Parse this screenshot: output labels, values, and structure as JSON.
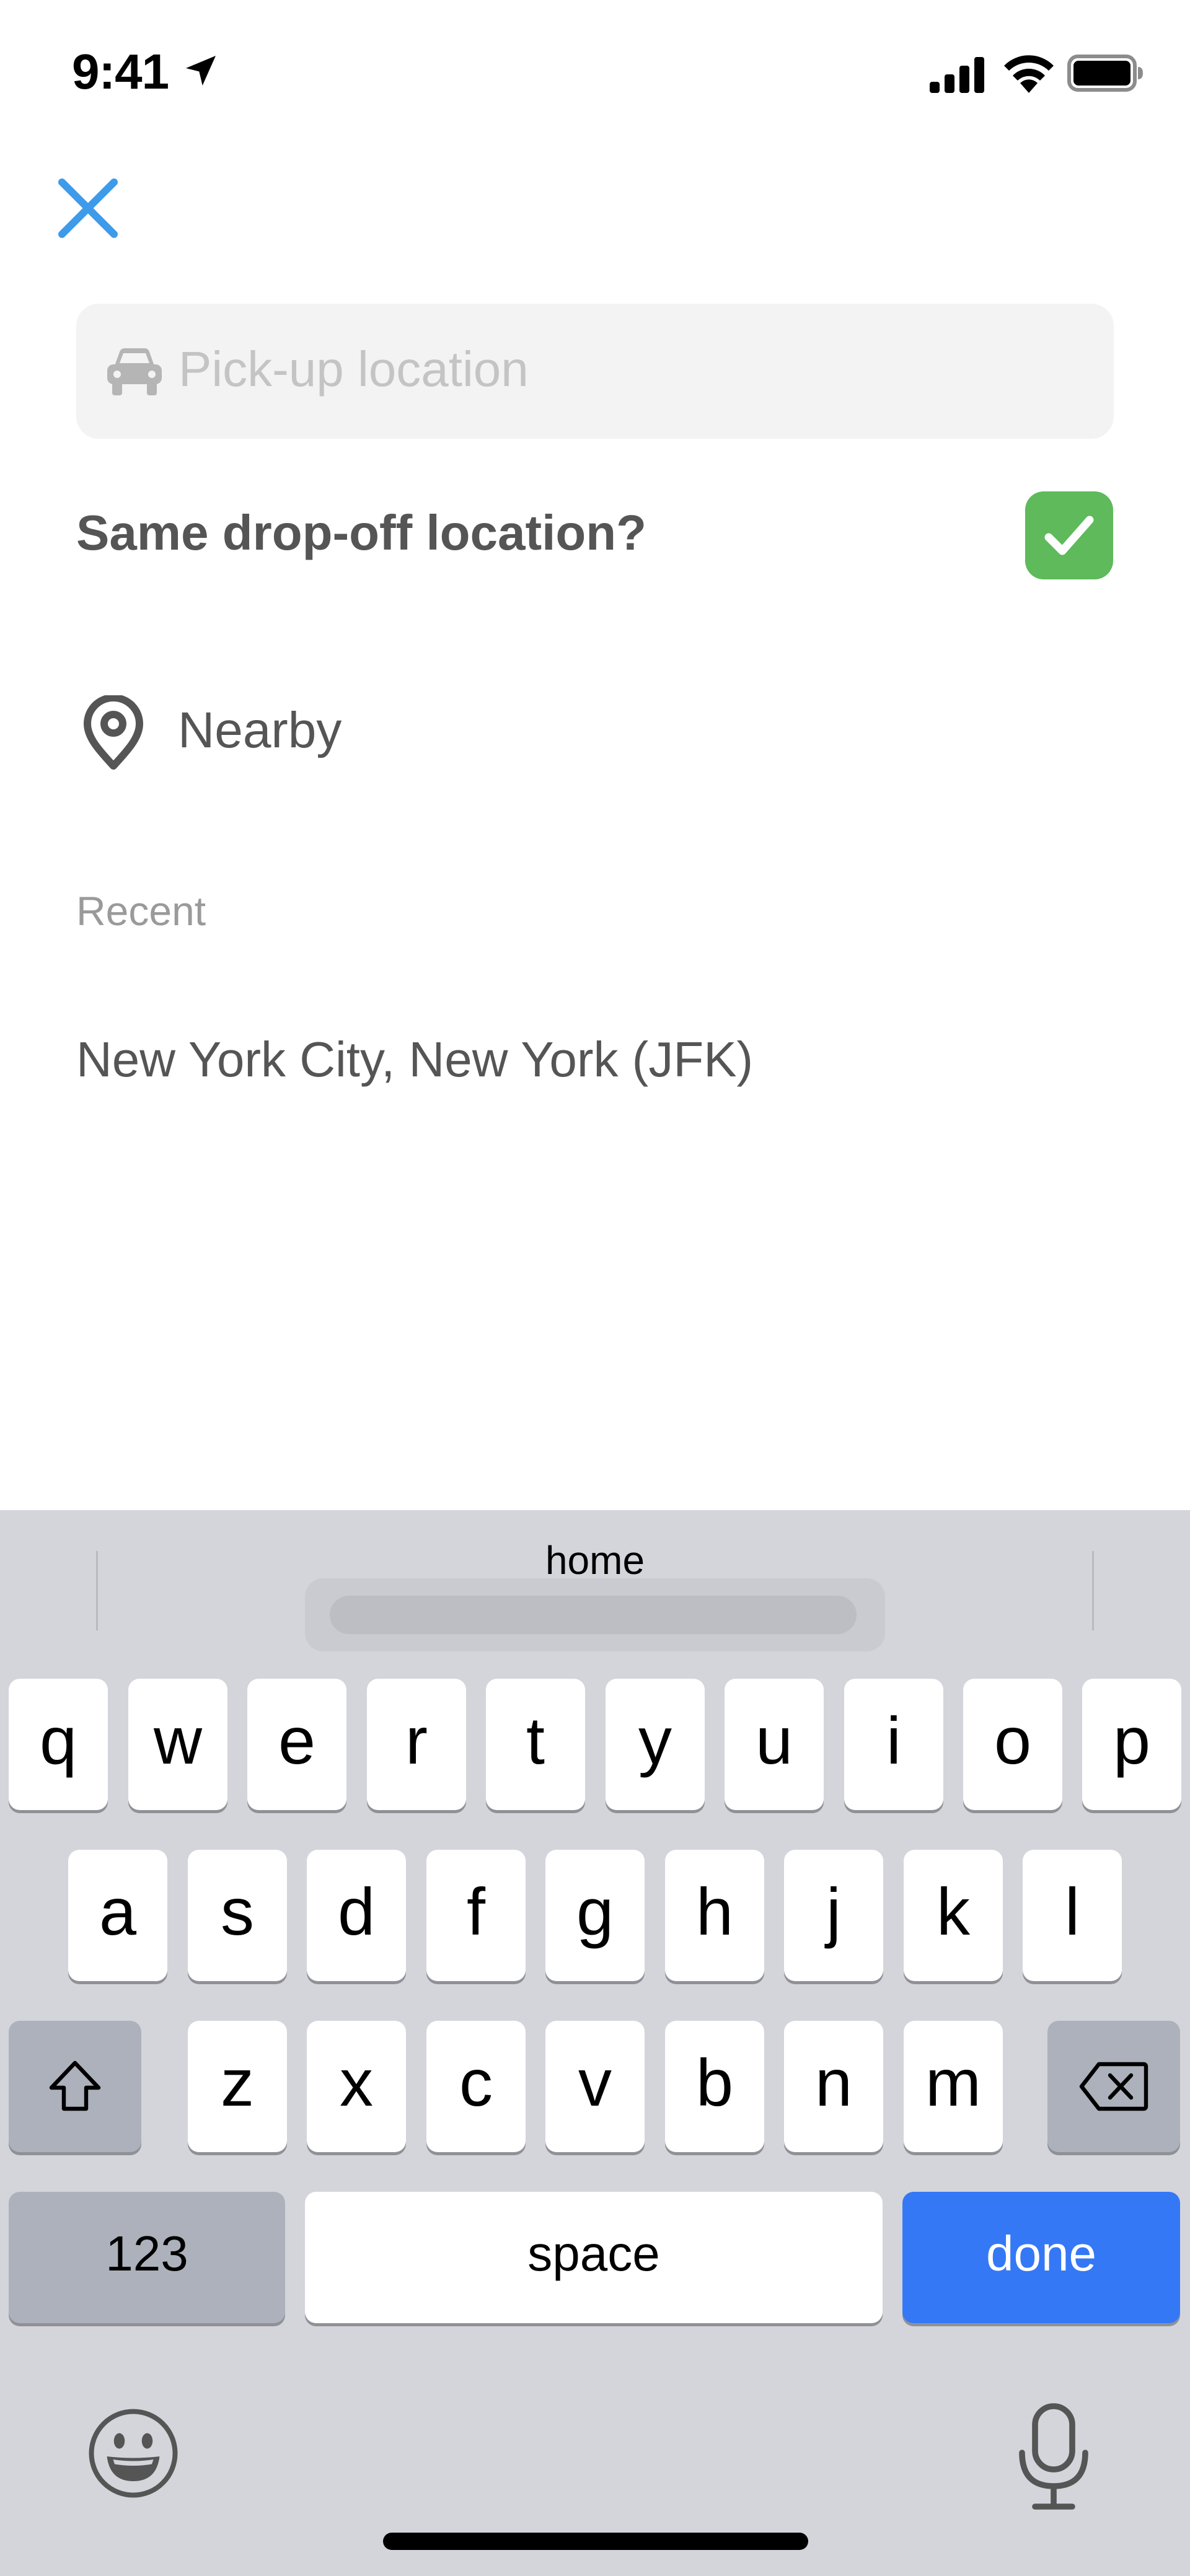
{
  "status_bar": {
    "time": "9:41"
  },
  "search": {
    "placeholder": "Pick-up location"
  },
  "same_dropoff": {
    "label": "Same drop-off location?",
    "checked": true
  },
  "nearby": {
    "label": "Nearby"
  },
  "recent": {
    "header": "Recent",
    "items": [
      "New York City, New York (JFK)"
    ]
  },
  "keyboard": {
    "suggestion": "home",
    "row1": [
      "q",
      "w",
      "e",
      "r",
      "t",
      "y",
      "u",
      "i",
      "o",
      "p"
    ],
    "row2": [
      "a",
      "s",
      "d",
      "f",
      "g",
      "h",
      "j",
      "k",
      "l"
    ],
    "row3": [
      "z",
      "x",
      "c",
      "v",
      "b",
      "n",
      "m"
    ],
    "numbers_label": "123",
    "space_label": "space",
    "done_label": "done"
  },
  "colors": {
    "accent_blue": "#3d9be9",
    "check_green": "#5eba5a",
    "done_blue": "#3478f6"
  },
  "icons": [
    "location-arrow-icon",
    "signal-icon",
    "wifi-icon",
    "battery-icon",
    "close-icon",
    "car-icon",
    "check-icon",
    "pin-icon",
    "shift-icon",
    "backspace-icon",
    "emoji-icon",
    "mic-icon"
  ]
}
